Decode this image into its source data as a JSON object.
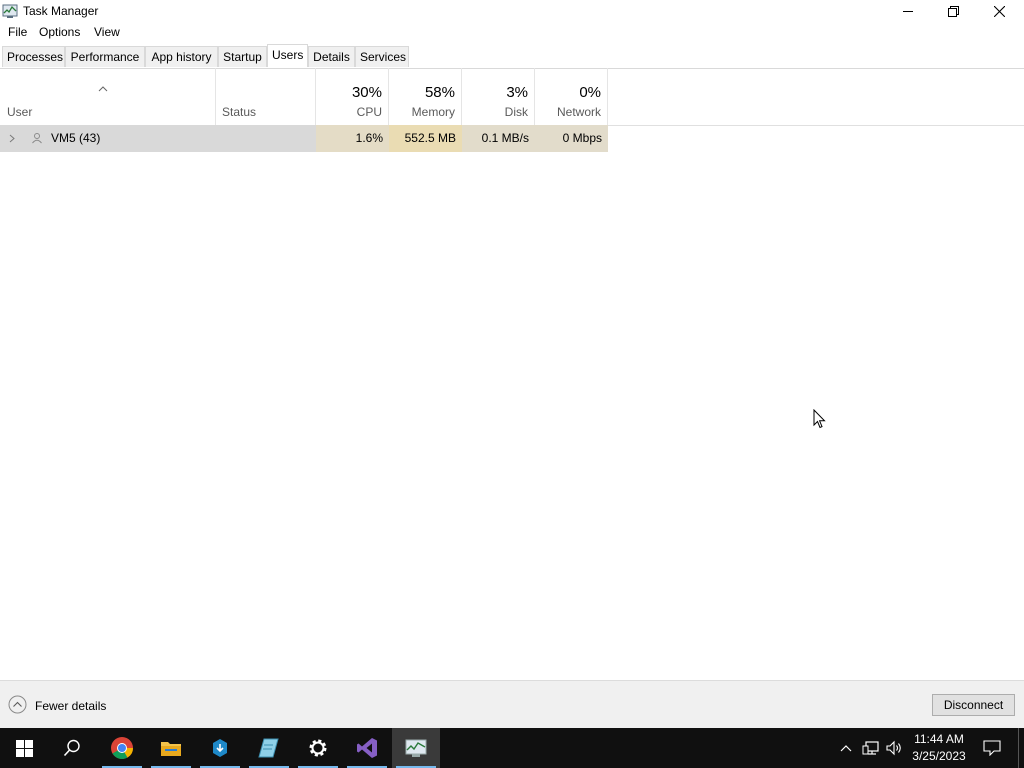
{
  "window": {
    "title": "Task Manager"
  },
  "menu": [
    "File",
    "Options",
    "View"
  ],
  "tabs": [
    "Processes",
    "Performance",
    "App history",
    "Startup",
    "Users",
    "Details",
    "Services"
  ],
  "active_tab": "Users",
  "columns": {
    "user": {
      "label": "User"
    },
    "status": {
      "label": "Status"
    },
    "cpu": {
      "label": "CPU",
      "pct": "30%"
    },
    "memory": {
      "label": "Memory",
      "pct": "58%"
    },
    "disk": {
      "label": "Disk",
      "pct": "3%"
    },
    "network": {
      "label": "Network",
      "pct": "0%"
    }
  },
  "rows": [
    {
      "user": "VM5 (43)",
      "status": "",
      "cpu": "1.6%",
      "memory": "552.5 MB",
      "disk": "0.1 MB/s",
      "network": "0 Mbps"
    }
  ],
  "footer": {
    "fewer_details": "Fewer details",
    "disconnect": "Disconnect"
  },
  "taskbar": {
    "apps": [
      "start-icon",
      "search-icon",
      "chrome-icon",
      "file-explorer-icon",
      "vs-installer-icon",
      "notepad-icon",
      "settings-icon",
      "visual-studio-icon",
      "task-manager-icon"
    ],
    "clock": {
      "time": "11:44 AM",
      "date": "3/25/2023"
    }
  },
  "colors": {
    "row_selected": "#d9d9d9",
    "heat_light": "#fff4c4",
    "taskbar": "#101010",
    "accent": "#76b9ed"
  }
}
